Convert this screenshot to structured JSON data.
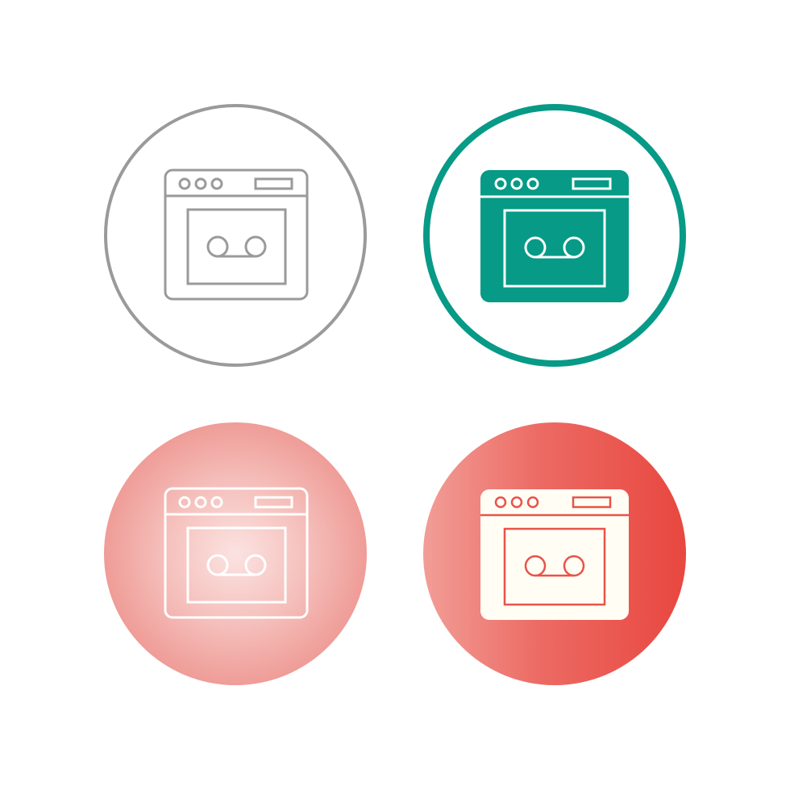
{
  "icon_set": {
    "icon": "cassette-player-window-icon",
    "variants": [
      {
        "id": "outline",
        "style": "line",
        "circle": "outlined",
        "stroke_color": "#9a9a9a",
        "background": "#ffffff"
      },
      {
        "id": "filled",
        "style": "glyph",
        "circle": "outlined",
        "accent_color": "#079a86",
        "background": "#ffffff"
      },
      {
        "id": "gradient-line",
        "style": "line",
        "circle": "filled-radial-gradient",
        "gradient_colors": [
          "#fbe3e1",
          "#ef9c97"
        ],
        "stroke_color": "#ffffff"
      },
      {
        "id": "gradient-glyph",
        "style": "glyph",
        "circle": "filled-linear-gradient",
        "gradient_colors": [
          "#f29d97",
          "#e8473f"
        ],
        "glyph_color": "#fffdf4"
      }
    ]
  }
}
